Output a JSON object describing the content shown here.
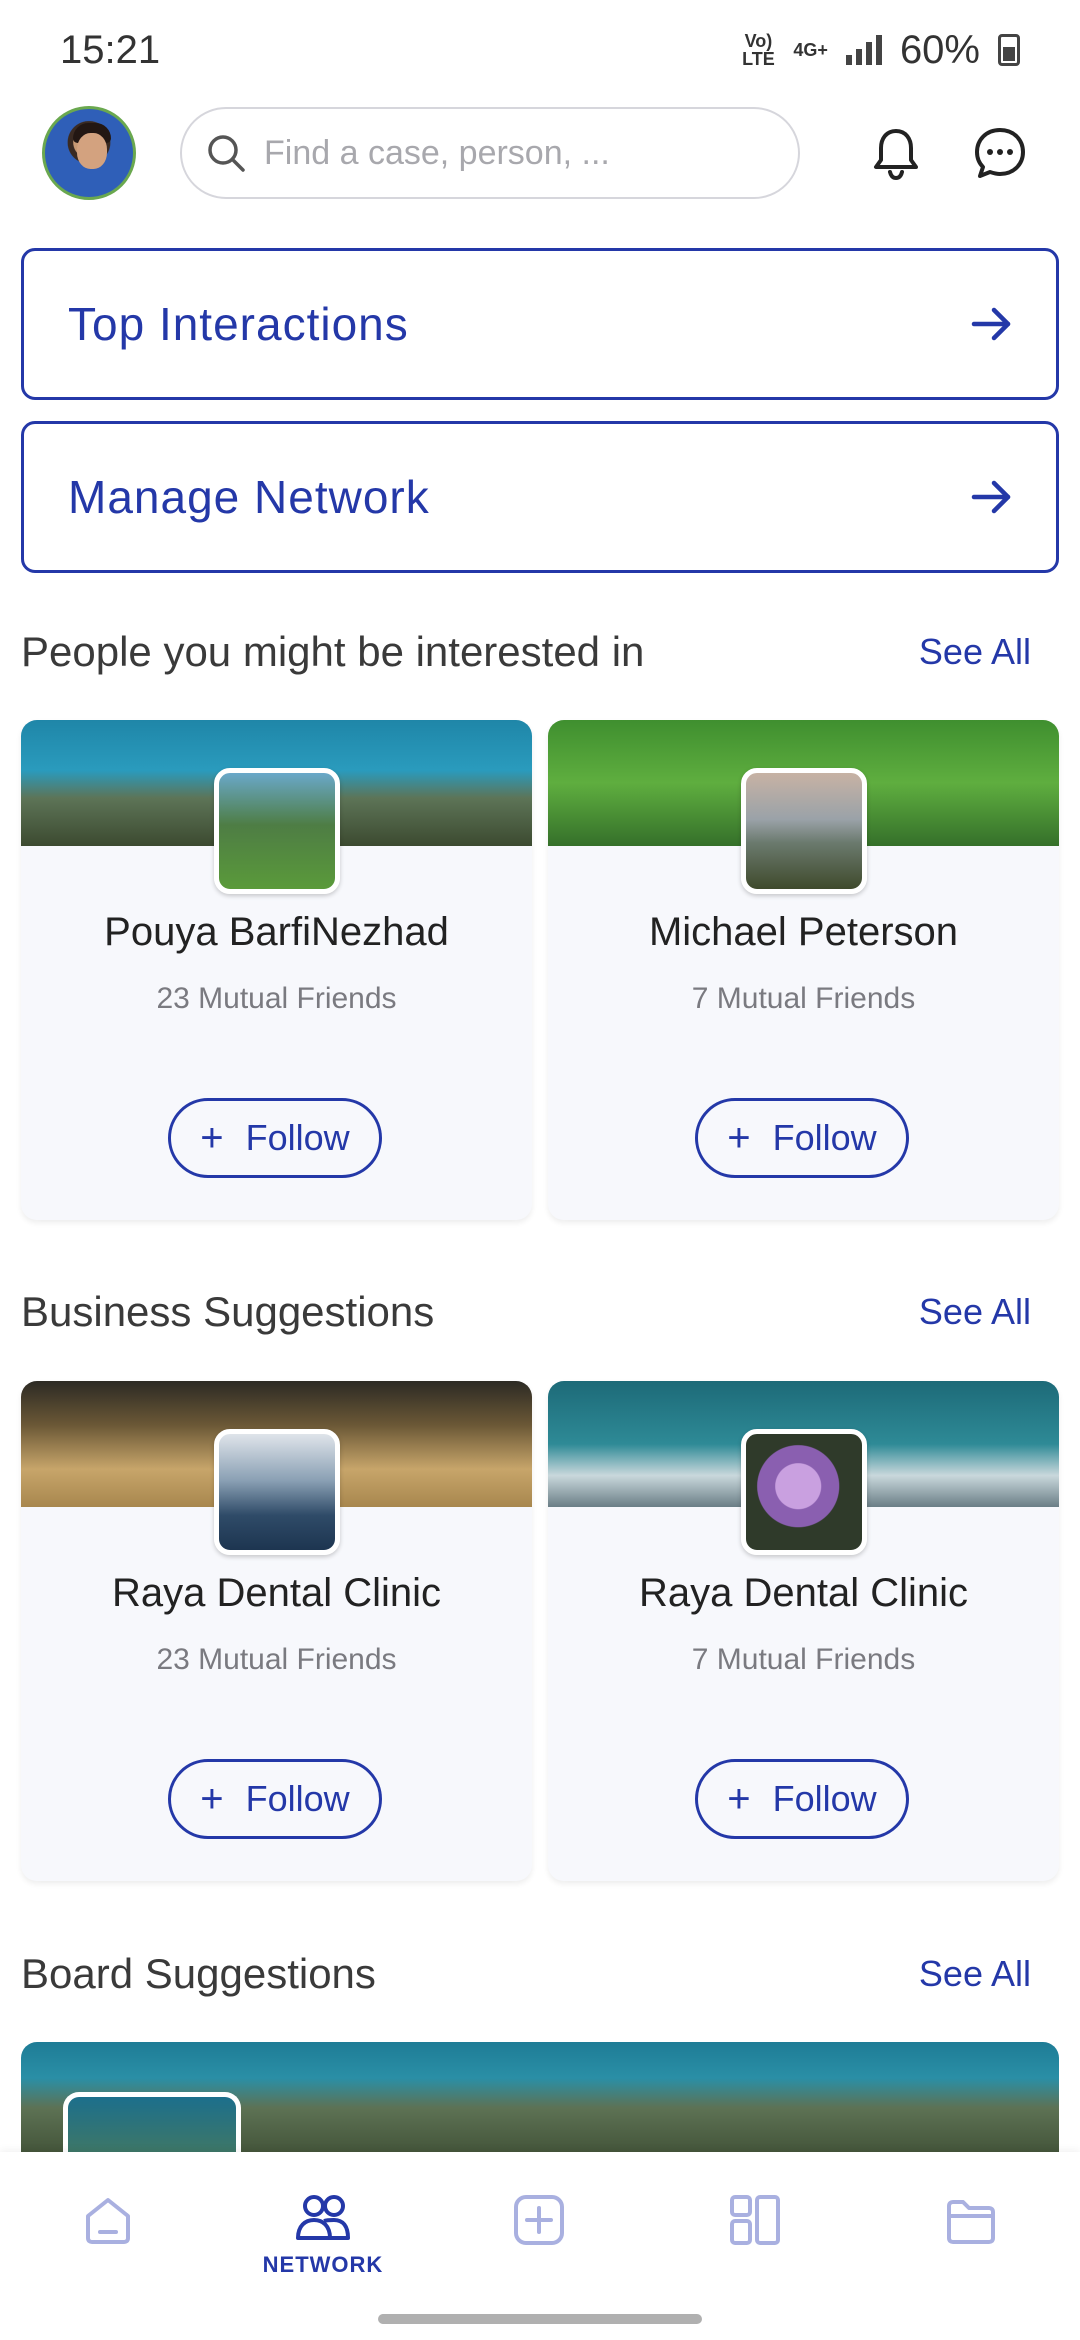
{
  "status": {
    "time": "15:21",
    "network1": "Vo) LTE",
    "network2": "4G+",
    "battery": "60%"
  },
  "search": {
    "placeholder": "Find a case, person, ..."
  },
  "links": [
    {
      "label": "Top Interactions"
    },
    {
      "label": "Manage Network"
    }
  ],
  "people": {
    "title": "People you might be interested in",
    "see_all": "See All",
    "cards": [
      {
        "name": "Pouya BarfiNezhad",
        "mutual": "23 Mutual Friends",
        "follow": "Follow"
      },
      {
        "name": "Michael Peterson",
        "mutual": "7 Mutual Friends",
        "follow": "Follow"
      }
    ]
  },
  "business": {
    "title": "Business Suggestions",
    "see_all": "See All",
    "cards": [
      {
        "name": "Raya Dental Clinic",
        "mutual": "23 Mutual Friends",
        "follow": "Follow"
      },
      {
        "name": "Raya Dental Clinic",
        "mutual": "7 Mutual Friends",
        "follow": "Follow"
      }
    ]
  },
  "board": {
    "title": "Board Suggestions",
    "see_all": "See All"
  },
  "nav": {
    "active_label": "NETWORK",
    "accent": "#2438a8",
    "inactive": "#a9b0e0"
  },
  "icons": [
    "home-icon",
    "network-icon",
    "add-icon",
    "dashboard-icon",
    "briefcase-icon",
    "bell-icon",
    "chat-icon",
    "search-icon",
    "arrow-right-icon",
    "plus-icon"
  ]
}
